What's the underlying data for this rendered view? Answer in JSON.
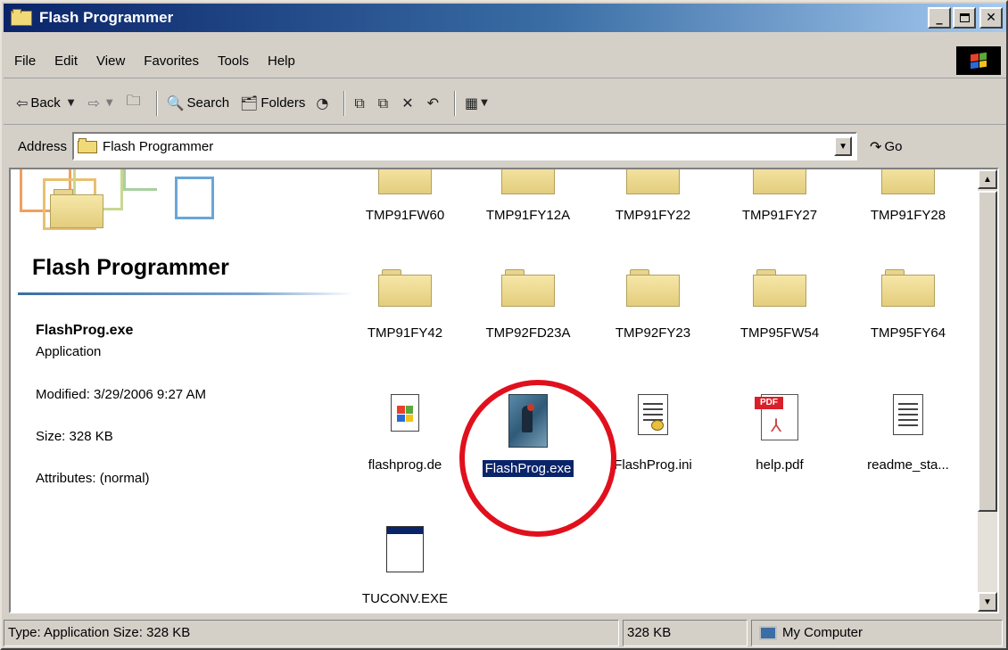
{
  "window": {
    "title": "Flash Programmer"
  },
  "menu": [
    "File",
    "Edit",
    "View",
    "Favorites",
    "Tools",
    "Help"
  ],
  "toolbar": {
    "back_label": "Back",
    "search_label": "Search",
    "folders_label": "Folders"
  },
  "address": {
    "label": "Address",
    "value": "Flash Programmer",
    "go_label": "Go"
  },
  "left_pane": {
    "title": "Flash Programmer",
    "selected_name": "FlashProg.exe",
    "selected_type": "Application",
    "modified": "Modified: 3/29/2006 9:27 AM",
    "size": "Size: 328 KB",
    "attributes": "Attributes: (normal)"
  },
  "folders_row1": [
    "TMP91FW60",
    "TMP91FY12A",
    "TMP91FY22",
    "TMP91FY27",
    "TMP91FY28"
  ],
  "folders_row2": [
    "TMP91FY42",
    "TMP92FD23A",
    "TMP92FY23",
    "TMP95FW54",
    "TMP95FY64"
  ],
  "files_row3": [
    "flashprog.de",
    "FlashProg.exe",
    "FlashProg.ini",
    "help.pdf",
    "readme_sta..."
  ],
  "files_row4": [
    "TUCONV.EXE"
  ],
  "pdf_badge": "PDF",
  "status": {
    "type_size": "Type: Application Size: 328 KB",
    "size": "328 KB",
    "zone": "My Computer"
  },
  "colors": {
    "highlight_circle": "#e0101c",
    "selection": "#0a246a",
    "title_bar": "#0a246a"
  },
  "icons": [
    "folder-icon",
    "dll-file-icon",
    "flashprog-app-icon",
    "ini-file-icon",
    "pdf-file-icon",
    "text-file-icon",
    "exe-window-icon",
    "my-computer-icon"
  ]
}
